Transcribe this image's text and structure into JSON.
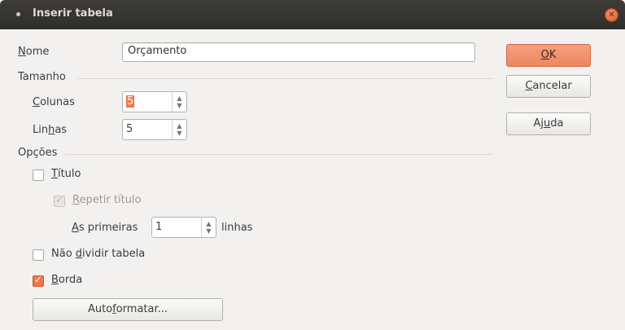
{
  "window": {
    "title": "Inserir tabela"
  },
  "nome": {
    "label": "Nome",
    "value": "Orçamento"
  },
  "tamanho": {
    "section": "Tamanho",
    "colunas_label": "Colunas",
    "colunas_value": "5",
    "linhas_label": "Linhas",
    "linhas_value": "5"
  },
  "opcoes": {
    "section": "Opções",
    "titulo": {
      "label": "Título",
      "checked": false
    },
    "repetir": {
      "label": "Repetir título",
      "checked": true,
      "disabled": true
    },
    "primeiras_label": "As primeiras",
    "primeiras_value": "1",
    "linhas_suffix": "linhas",
    "nao_dividir": {
      "label": "Não dividir tabela",
      "checked": false
    },
    "borda": {
      "label": "Borda",
      "checked": true
    },
    "autoformatar": "Autoformatar..."
  },
  "buttons": {
    "ok": "OK",
    "cancelar": "Cancelar",
    "ajuda": "Ajuda"
  },
  "colors": {
    "accent": "#f07746",
    "titlebar": "#3d3c38",
    "background": "#f2f1f0"
  }
}
